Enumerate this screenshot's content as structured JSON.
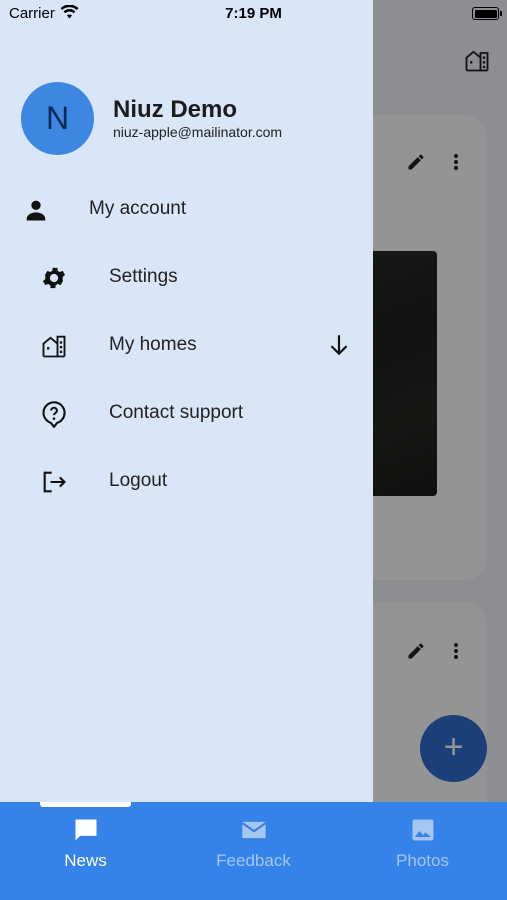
{
  "status_bar": {
    "carrier": "Carrier",
    "time": "7:19 PM"
  },
  "drawer": {
    "avatar_initial": "N",
    "user_name": "Niuz Demo",
    "user_email": "niuz-apple@mailinator.com",
    "items": [
      {
        "label": "My account",
        "icon": "person-icon"
      },
      {
        "label": "Settings",
        "icon": "gear-icon"
      },
      {
        "label": "My homes",
        "icon": "building-icon",
        "expand_icon": "arrow-down-icon"
      },
      {
        "label": "Contact support",
        "icon": "help-icon"
      },
      {
        "label": "Logout",
        "icon": "logout-icon"
      }
    ]
  },
  "tabbar": {
    "tabs": [
      {
        "label": "News",
        "icon": "chat-icon",
        "active": true
      },
      {
        "label": "Feedback",
        "icon": "mail-icon",
        "active": false
      },
      {
        "label": "Photos",
        "icon": "image-icon",
        "active": false
      }
    ]
  },
  "background": {
    "fab_label": "+"
  },
  "colors": {
    "drawer_bg": "#d9e6f8",
    "accent": "#3582e8",
    "avatar": "#3d86e2",
    "tab_inactive": "#a6c6f0"
  }
}
